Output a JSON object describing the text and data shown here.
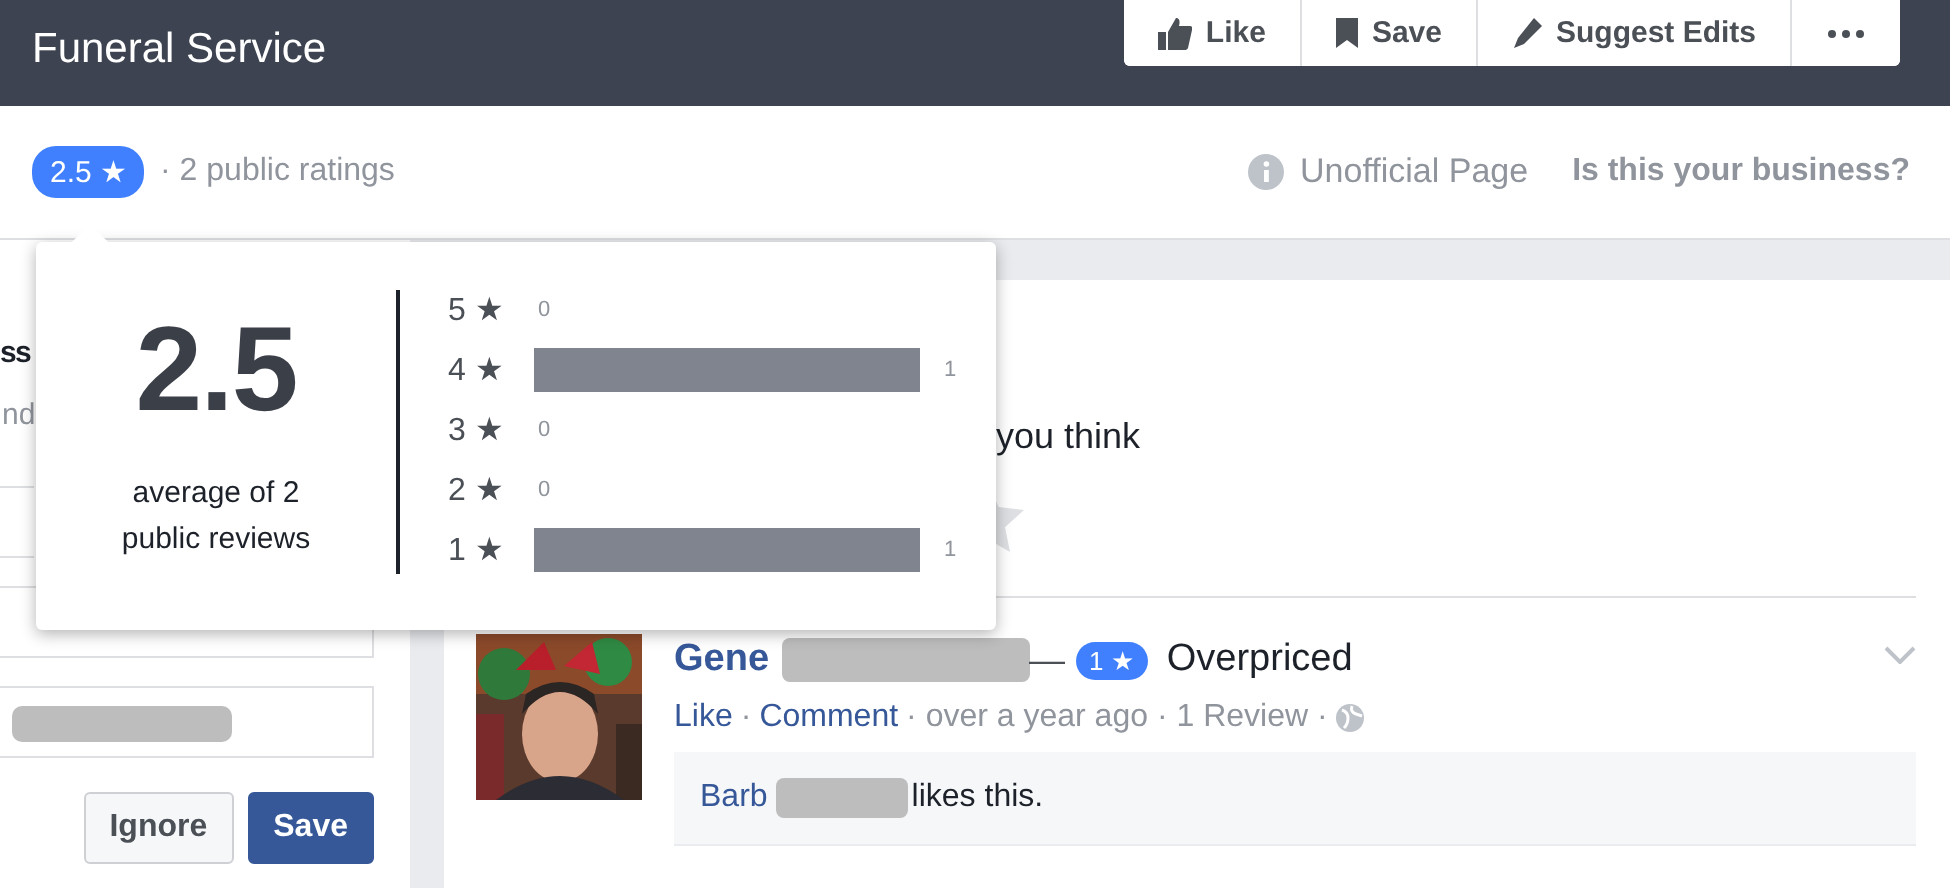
{
  "header": {
    "title": "Funeral Service",
    "actions": [
      {
        "kind": "like",
        "label": "Like"
      },
      {
        "kind": "save",
        "label": "Save"
      },
      {
        "kind": "edit",
        "label": "Suggest Edits"
      },
      {
        "kind": "more"
      }
    ]
  },
  "rating_bar": {
    "badge": "2.5 ★",
    "ratings": "· 2 public ratings",
    "status": "Unofficial Page",
    "claim_link": "Is this your business?"
  },
  "left_panel": {
    "heading": "ss",
    "subtext": "nd",
    "fields": [
      {
        "kind": "partial"
      },
      {
        "kind": "empty"
      },
      {
        "kind": "redacted"
      }
    ],
    "buttons": [
      {
        "kind": "secondary",
        "label": "Ignore"
      },
      {
        "kind": "primary",
        "label": "Save"
      }
    ]
  },
  "review_prompt": {
    "text": "you think"
  },
  "review": {
    "author": "Gene",
    "author_redacted": true,
    "dash": "—",
    "badge": "1 ★",
    "title": "Overpriced",
    "actions": [
      {
        "kind": "link",
        "text": "Like"
      },
      {
        "kind": "meta",
        "text": "·"
      },
      {
        "kind": "link",
        "text": "Comment"
      },
      {
        "kind": "meta",
        "text": "· over a year ago · 1 Review ·"
      },
      {
        "kind": "globe"
      }
    ],
    "likes": {
      "name": "Barb",
      "name_redacted": true,
      "text": "likes this."
    }
  },
  "popover": {
    "average": "2.5",
    "caption": "average of 2 public reviews",
    "histogram": [
      {
        "label": "5 ★",
        "count": "0",
        "bar": false
      },
      {
        "label": "4 ★",
        "count": "1",
        "bar": true
      },
      {
        "label": "3 ★",
        "count": "0",
        "bar": false
      },
      {
        "label": "2 ★",
        "count": "0",
        "bar": false
      },
      {
        "label": "1 ★",
        "count": "1",
        "bar": true
      }
    ]
  }
}
